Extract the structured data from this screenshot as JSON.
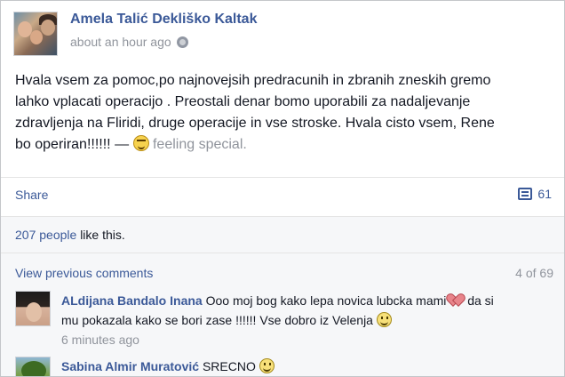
{
  "post": {
    "author": "Amela Talić Dekliško Kaltak",
    "timestamp": "about an hour ago",
    "privacy_icon": "globe-icon",
    "text_lines": [
      "Hvala vsem za pomoc,po najnovejsih predracunih in zbranih zneskih gremo",
      "lahko vplacati operacijo . Preostali denar bomo uporabili za nadaljevanje",
      "zdravljenja na Fliridi, druge operacije in vse stroske. Hvala cisto vsem, Rene"
    ],
    "last_line_text": "bo operiran!!!!!! —",
    "feeling_icon": "grinning-smiley-icon",
    "feeling_text": "feeling special."
  },
  "actions": {
    "share_label": "Share",
    "comment_icon": "comment-icon",
    "comment_count": "61"
  },
  "likes": {
    "count_text": "207 people",
    "suffix": "like this."
  },
  "comments": {
    "view_previous_label": "View previous comments",
    "pager": "4 of 69",
    "items": [
      {
        "author": "ALdijana Bandalo Inana",
        "text_part1": "Ooo moj bog kako lepa novica lubcka mami",
        "heart_icon": "heart-icon",
        "text_part2": "da si",
        "text_line2": "mu pokazala kako se bori zase !!!!!! Vse dobro iz Velenja",
        "smile_icon": "smile-icon",
        "time": "6 minutes ago"
      },
      {
        "author": "Sabina Almir Muratović",
        "text": "SRECNO",
        "smile_icon": "smile-icon"
      }
    ]
  },
  "colors": {
    "link": "#3b5998",
    "meta": "#90949c",
    "text": "#141823",
    "comment_bg": "#f6f7f9"
  }
}
